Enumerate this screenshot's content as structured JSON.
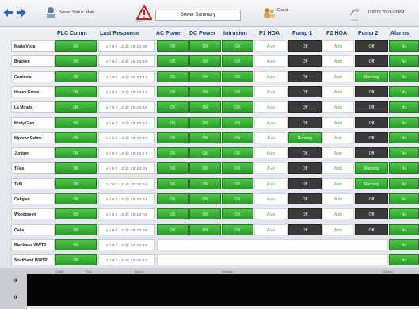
{
  "header": {
    "back_icon": "left-arrow-icon",
    "forward_icon": "right-arrow-icon",
    "server_status": "Server Status: Main",
    "alarm_icon_sub": "Alarm",
    "title": "Sewer Summary",
    "user": "Guest",
    "logout_sub": "Logout",
    "datetime": "1/08/13 20:24:43 PM"
  },
  "columns": {
    "plc_comm": "PLC Comm",
    "last_response": "Last Response",
    "ac_power": "AC Power",
    "dc_power": "DC Power",
    "intrusion": "Intrusion",
    "p1_hoa": "P1 HOA",
    "pump1": "Pump 1",
    "p2_hoa": "P2 HOA",
    "pump2": "Pump 2",
    "alarms": "Alarms"
  },
  "rows": [
    {
      "name": "Maria Vista",
      "plc": "OK",
      "last": "1 / 8 / 13 @ 20:24:06",
      "ac": "OK",
      "dc": "OK",
      "intr": "OK",
      "p1hoa": "Auto",
      "pump1": "Off",
      "p2hoa": "Auto",
      "pump2": "Off",
      "alarms": "No"
    },
    {
      "name": "Bracken",
      "plc": "OK",
      "last": "1 / 8 / 13 @ 20:24:10",
      "ac": "OK",
      "dc": "OK",
      "intr": "OK",
      "p1hoa": "Auto",
      "pump1": "Off",
      "p2hoa": "Auto",
      "pump2": "Off",
      "alarms": "No"
    },
    {
      "name": "Gardenia",
      "plc": "OK",
      "last": "1 / 8 / 13 @ 20:24:11",
      "ac": "OK",
      "dc": "OK",
      "intr": "OK",
      "p1hoa": "Auto",
      "pump1": "Off",
      "p2hoa": "Auto",
      "pump2": "Running",
      "alarms": "No"
    },
    {
      "name": "Honey Grove",
      "plc": "OK",
      "last": "1 / 8 / 13 @ 20:24:12",
      "ac": "OK",
      "dc": "OK",
      "intr": "OK",
      "p1hoa": "Auto",
      "pump1": "Off",
      "p2hoa": "Auto",
      "pump2": "Off",
      "alarms": "No"
    },
    {
      "name": "La Mirada",
      "plc": "OK",
      "last": "1 / 8 / 13 @ 20:24:16",
      "ac": "OK",
      "dc": "OK",
      "intr": "OK",
      "p1hoa": "Auto",
      "pump1": "Off",
      "p2hoa": "Auto",
      "pump2": "Off",
      "alarms": "No"
    },
    {
      "name": "Misty Glen",
      "plc": "OK",
      "last": "1 / 8 / 13 @ 20:23:47",
      "ac": "OK",
      "dc": "OK",
      "intr": "OK",
      "p1hoa": "Auto",
      "pump1": "Off",
      "p2hoa": "Auto",
      "pump2": "Off",
      "alarms": "No"
    },
    {
      "name": "Nipomo Palms",
      "plc": "OK",
      "last": "1 / 8 / 13 @ 20:23:43",
      "ac": "OK",
      "dc": "OK",
      "intr": "OK",
      "p1hoa": "Auto",
      "pump1": "Running",
      "p2hoa": "Auto",
      "pump2": "Off",
      "alarms": "No"
    },
    {
      "name": "Juniper",
      "plc": "OK",
      "last": "1 / 8 / 13 @ 20:24:17",
      "ac": "OK",
      "dc": "OK",
      "intr": "OK",
      "p1hoa": "Auto",
      "pump1": "Off",
      "p2hoa": "Auto",
      "pump2": "Off",
      "alarms": "No"
    },
    {
      "name": "Tejas",
      "plc": "OK",
      "last": "1 / 8 / 13 @ 20:24:01",
      "ac": "OK",
      "dc": "OK",
      "intr": "OK",
      "p1hoa": "Auto",
      "pump1": "Off",
      "p2hoa": "Auto",
      "pump2": "Running",
      "alarms": "No"
    },
    {
      "name": "Taffi",
      "plc": "OK",
      "last": "1 / 8 / 13 @ 20:23:54",
      "ac": "OK",
      "dc": "OK",
      "intr": "OK",
      "p1hoa": "Auto",
      "pump1": "Off",
      "p2hoa": "Auto",
      "pump2": "Running",
      "alarms": "No"
    },
    {
      "name": "Oakglen",
      "plc": "OK",
      "last": "1 / 8 / 13 @ 20:23:51",
      "ac": "OK",
      "dc": "OK",
      "intr": "OK",
      "p1hoa": "Auto",
      "pump1": "Off",
      "p2hoa": "Auto",
      "pump2": "Off",
      "alarms": "No"
    },
    {
      "name": "Woodgreen",
      "plc": "OK",
      "last": "1 / 8 / 13 @ 20:24:02",
      "ac": "OK",
      "dc": "OK",
      "intr": "OK",
      "p1hoa": "Auto",
      "pump1": "Off",
      "p2hoa": "Auto",
      "pump2": "Off",
      "alarms": "No"
    },
    {
      "name": "Oaks",
      "plc": "OK",
      "last": "1 / 8 / 13 @ 20:23:59",
      "ac": "OK",
      "dc": "OK",
      "intr": "OK",
      "p1hoa": "Auto",
      "pump1": "Off",
      "p2hoa": "Auto",
      "pump2": "Off",
      "alarms": "No"
    },
    {
      "name": "Blacklake WWTP",
      "plc": "OK",
      "last": "1 / 8 / 13 @ 20:24:16",
      "ac": "",
      "dc": "",
      "intr": "",
      "p1hoa": "",
      "pump1": "",
      "p2hoa": "",
      "pump2": "",
      "alarms": "No"
    },
    {
      "name": "Southland WWTP",
      "plc": "OK",
      "last": "1 / 8 / 13 @ 20:24:17",
      "ac": "",
      "dc": "",
      "intr": "",
      "p1hoa": "",
      "pump1": "",
      "p2hoa": "",
      "pump2": "",
      "alarms": "No"
    }
  ],
  "alarm_panel": {
    "headers": [
      "Quality",
      "Time",
      "Source",
      "Message",
      "Category"
    ],
    "count_top": "0",
    "count_bottom": "0"
  },
  "colors": {
    "ok_green": "#2a9d2a",
    "off_black": "#3a3a3a",
    "header_blue": "#1f3f7a"
  }
}
